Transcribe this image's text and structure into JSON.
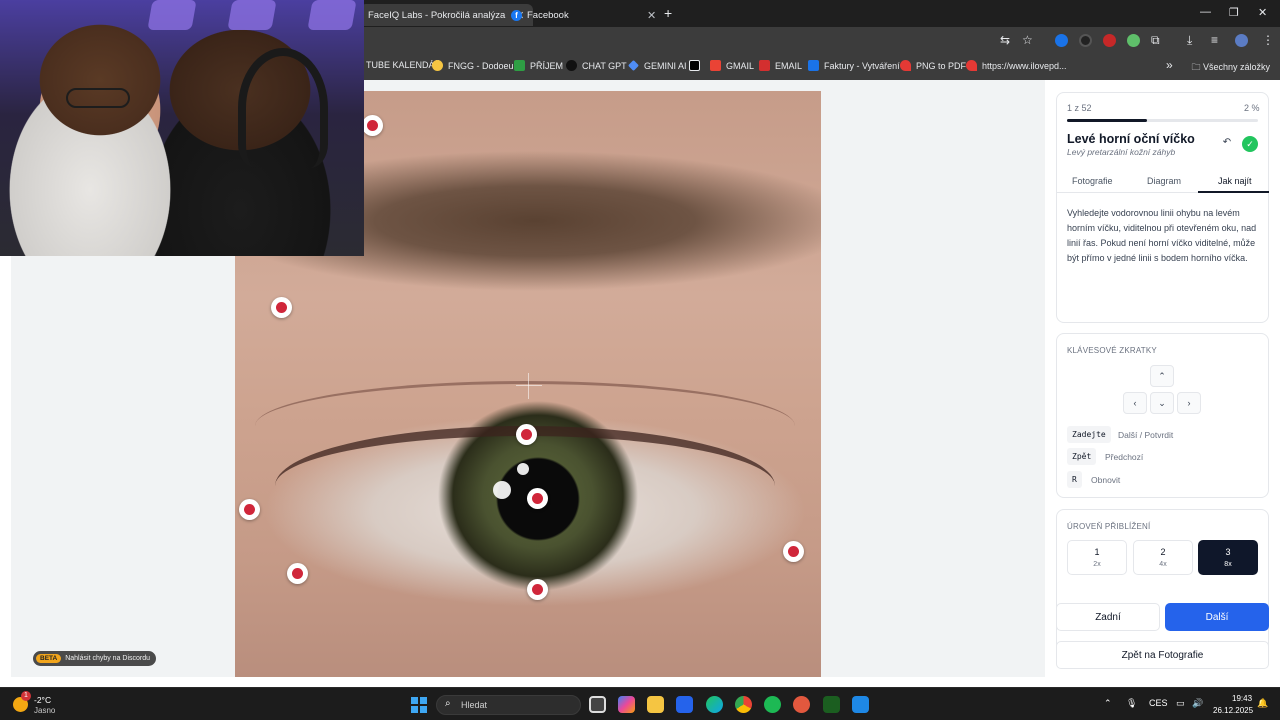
{
  "browser": {
    "tabs": [
      {
        "title": "FaceIQ Labs - Pokročilá analýza",
        "active": true
      },
      {
        "title": "Facebook",
        "active": false
      }
    ],
    "bookmarks": [
      {
        "label": "TUBE KALENDÁŘ",
        "color": "#e53935"
      },
      {
        "label": "FNGG - Dodoeu",
        "color": "#f5c542"
      },
      {
        "label": "PŘÍJEM",
        "color": "#2e9e44"
      },
      {
        "label": "CHAT GPT",
        "color": "#111111"
      },
      {
        "label": "GEMINI AI",
        "color": "#4f8df6"
      },
      {
        "label": "",
        "color": "#e8eaed"
      },
      {
        "label": "GMAIL",
        "color": "#ea4335"
      },
      {
        "label": "EMAIL",
        "color": "#d32f2f"
      },
      {
        "label": "Faktury - Vytváření",
        "color": "#1a73e8"
      },
      {
        "label": "PNG to PDF",
        "color": "#e53935"
      },
      {
        "label": "https://www.ilovepd...",
        "color": "#e53935"
      }
    ],
    "all_bookmarks": "Všechny záložky"
  },
  "workspace": {
    "beta_tag": "BETA",
    "beta_text": "Nahlásit chyby na Discordu"
  },
  "panel": {
    "progress_label": "1 z 52",
    "progress_percent_label": "2 %",
    "progress_fraction": 0.02,
    "title": "Levé horní oční víčko",
    "subtitle": "Levý pretarzální kožní záhyb",
    "tabs": [
      "Fotografie",
      "Diagram",
      "Jak najít"
    ],
    "active_tab": "Jak najít",
    "description": "Vyhledejte vodorovnou linii ohybu na levém horním víčku, viditelnou při otevřeném oku, nad linií řas. Pokud není horní víčko viditelné, může být přímo v jedné linii s bodem horního víčka.",
    "shortcuts": {
      "title": "KLÁVESOVÉ ZKRATKY",
      "arrows": {
        "up": "⌃",
        "left": "‹",
        "down": "⌄",
        "right": "›"
      },
      "keys": [
        {
          "key": "Zadejte",
          "label": "Další / Potvrdit"
        },
        {
          "key": "Zpět",
          "label": "Předchozí"
        },
        {
          "key": "R",
          "label": "Obnovit"
        }
      ]
    },
    "zoom": {
      "title": "ÚROVEŇ PŘIBLÍŽENÍ",
      "levels": [
        {
          "n": "1",
          "m": "2x"
        },
        {
          "n": "2",
          "m": "4x"
        },
        {
          "n": "3",
          "m": "8x"
        }
      ],
      "active": "3"
    },
    "buttons": {
      "back": "Zadní",
      "next": "Další",
      "photos": "Zpět na Fotografie"
    },
    "colors": {
      "accent": "#2563eb",
      "confirm": "#22c55e",
      "marker": "#d0263a"
    }
  },
  "taskbar": {
    "weather_badge": "1",
    "weather_temp": "-2°C",
    "weather_cond": "Jasno",
    "search_placeholder": "Hledat",
    "lang": "CES",
    "time": "19:43",
    "date": "26.12.2025"
  }
}
